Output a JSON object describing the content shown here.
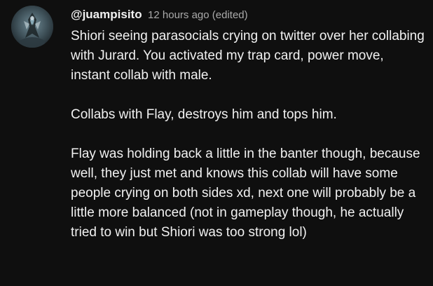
{
  "comment": {
    "author": "@juampisito",
    "timestamp": "12 hours ago (edited)",
    "avatar_icon": "character-avatar-icon",
    "paragraphs": [
      "Shiori seeing parasocials crying on twitter over her collabing with Jurard. You activated my trap card, power move, instant collab with male.",
      "Collabs with Flay, destroys him and tops him.",
      "Flay was holding back a little in the banter though, because well, they just met and knows this collab will have some people crying on both sides xd, next one will probably be a little more balanced (not in gameplay though, he actually tried to win but Shiori was too strong lol)"
    ]
  },
  "colors": {
    "background": "#0f0f0f",
    "text": "#f1f1f1",
    "meta": "#aaaaaa"
  }
}
